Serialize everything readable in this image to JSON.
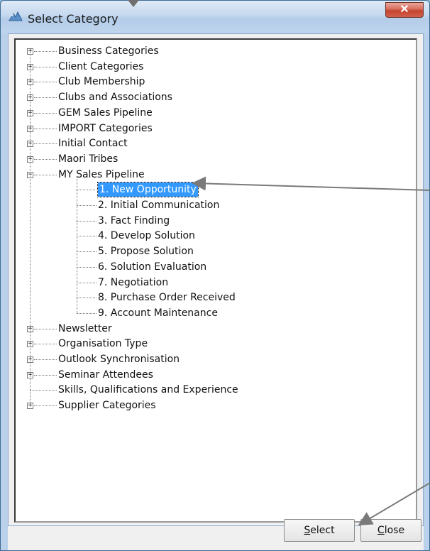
{
  "window": {
    "title": "Select Category",
    "close_label": "✕",
    "icon": "app-icon"
  },
  "tree": {
    "items": [
      {
        "label": "Business Categories",
        "expander": "+"
      },
      {
        "label": "Client Categories",
        "expander": "+"
      },
      {
        "label": "Club Membership",
        "expander": "+"
      },
      {
        "label": "Clubs and Associations",
        "expander": "+"
      },
      {
        "label": "GEM Sales Pipeline",
        "expander": "+"
      },
      {
        "label": "IMPORT Categories",
        "expander": "+"
      },
      {
        "label": "Initial Contact",
        "expander": "+"
      },
      {
        "label": "Maori Tribes",
        "expander": "+"
      },
      {
        "label": "MY Sales Pipeline",
        "expander": "−"
      },
      {
        "label": "Newsletter",
        "expander": "+"
      },
      {
        "label": "Organisation Type",
        "expander": "+"
      },
      {
        "label": "Outlook Synchronisation",
        "expander": "+"
      },
      {
        "label": "Seminar Attendees",
        "expander": "+"
      },
      {
        "label": "Skills, Qualifications and Experience",
        "expander": ""
      },
      {
        "label": "Supplier Categories",
        "expander": "+"
      }
    ],
    "children": [
      {
        "label": "1. New Opportunity",
        "selected": true
      },
      {
        "label": "2. Initial Communication"
      },
      {
        "label": "3. Fact Finding"
      },
      {
        "label": "4. Develop Solution"
      },
      {
        "label": "5. Propose Solution"
      },
      {
        "label": "6. Solution Evaluation"
      },
      {
        "label": "7. Negotiation"
      },
      {
        "label": "8. Purchase Order Received"
      },
      {
        "label": "9. Account Maintenance"
      }
    ]
  },
  "buttons": {
    "select_rest": "elect",
    "select_mnemonic": "S",
    "close_rest": "lose",
    "close_mnemonic": "C"
  },
  "colors": {
    "selection": "#3399ff",
    "annotation_arrow": "#7a7a7a"
  }
}
